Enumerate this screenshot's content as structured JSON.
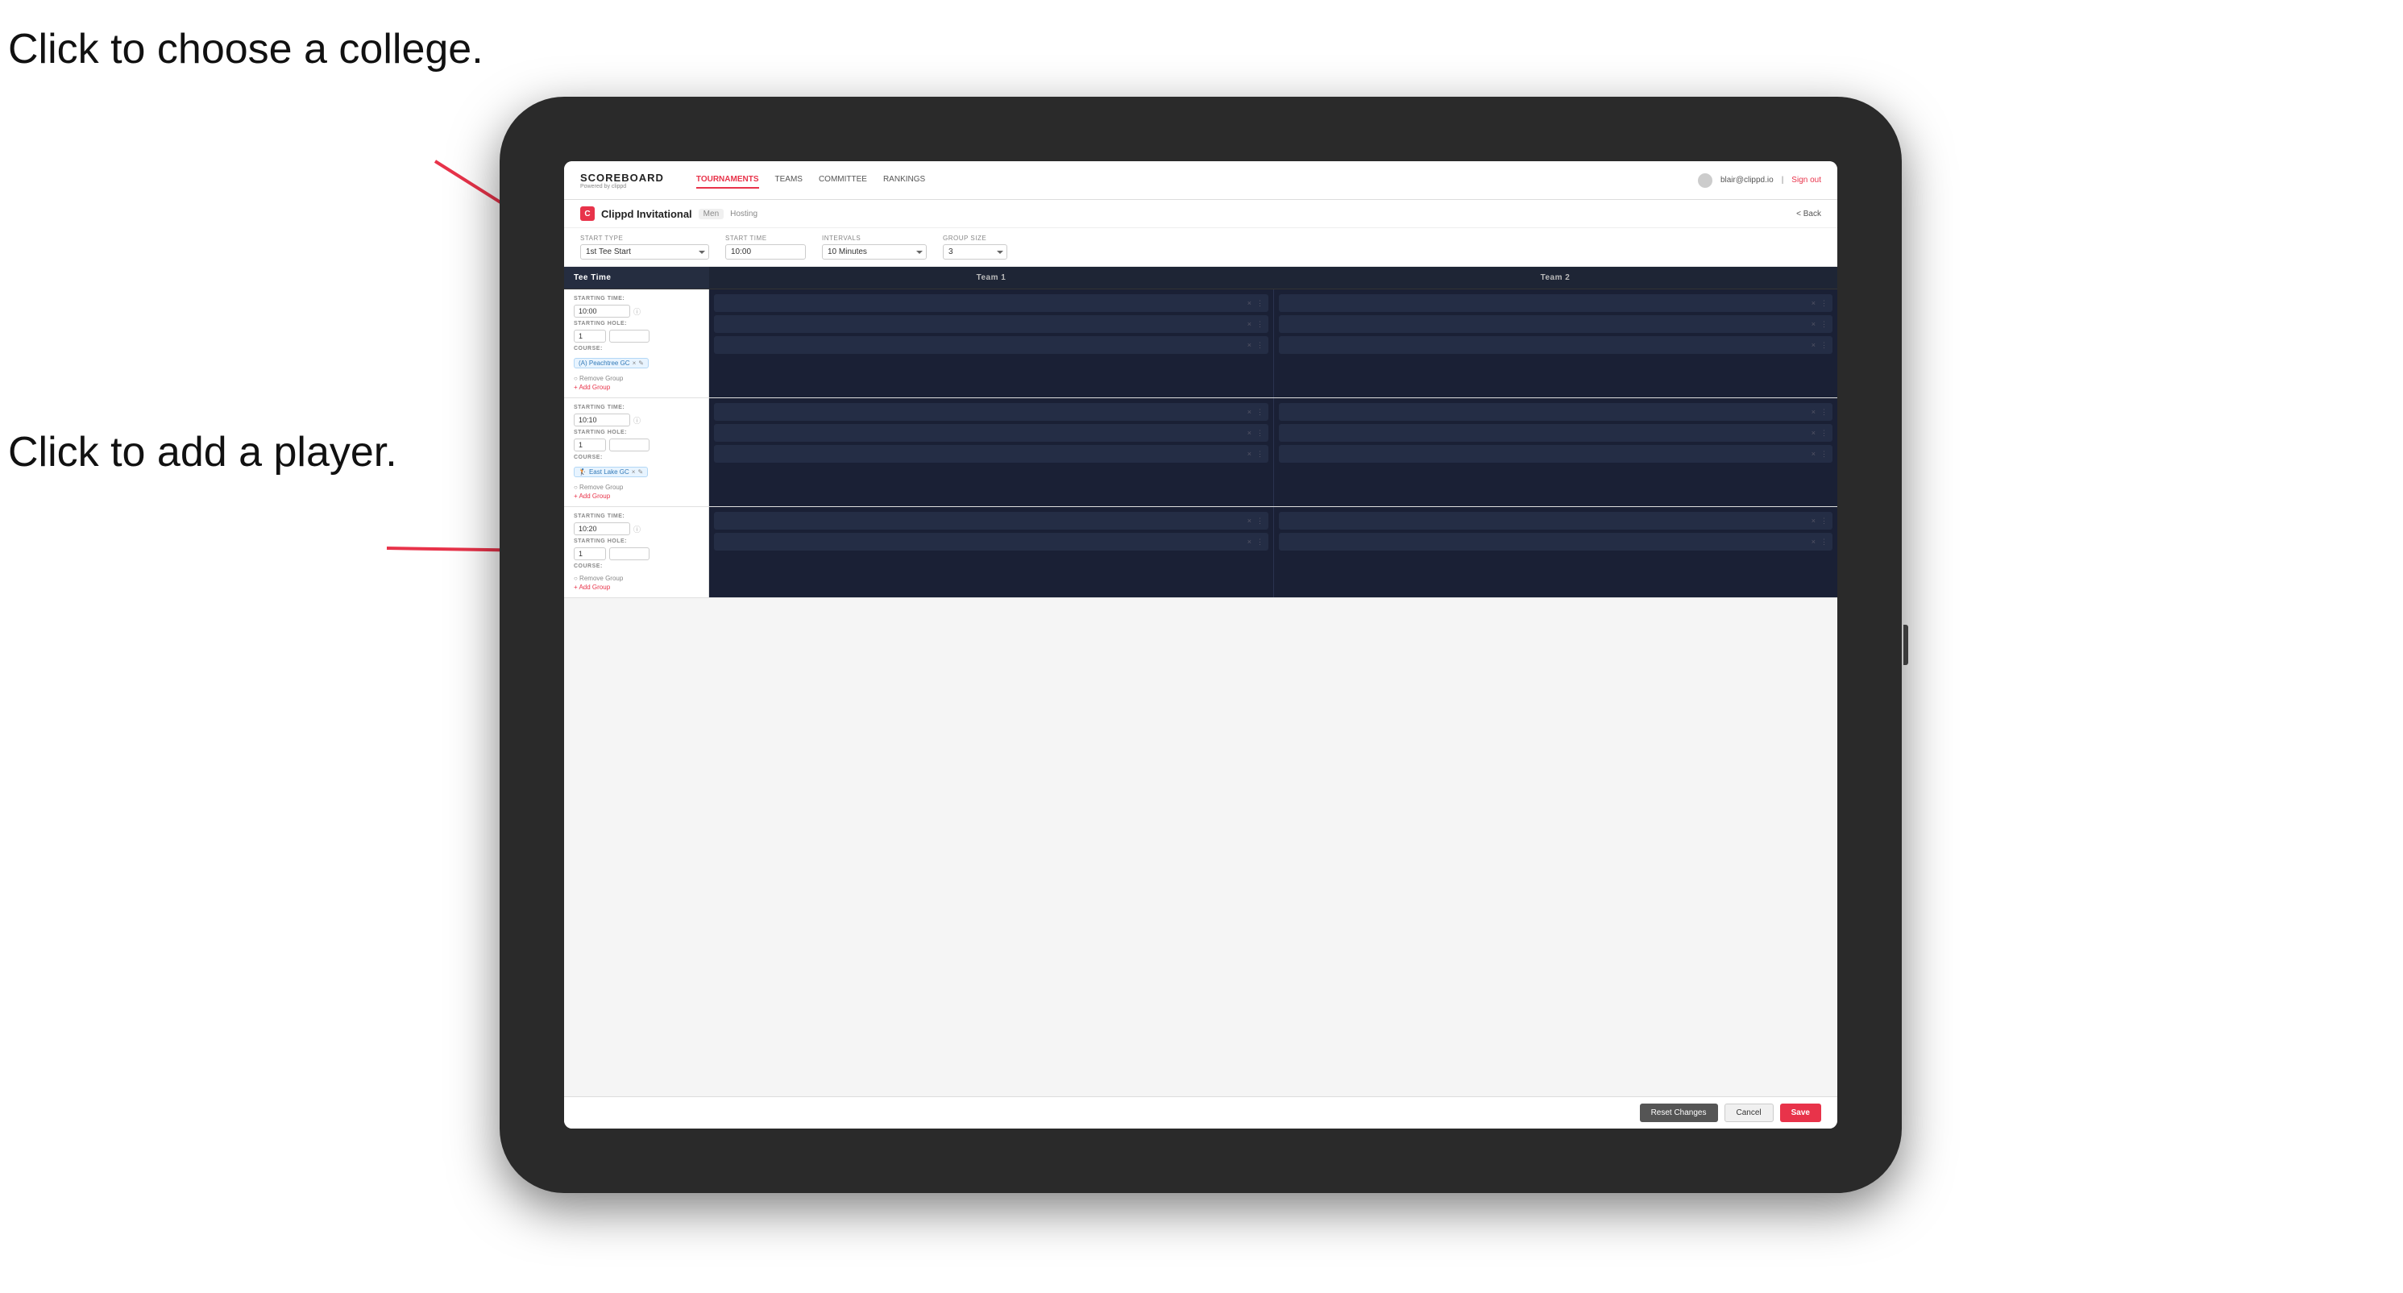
{
  "annotations": {
    "top_left": "Click to choose a\ncollege.",
    "bottom_left": "Click to add\na player."
  },
  "nav": {
    "brand": "SCOREBOARD",
    "brand_sub": "Powered by clippd",
    "links": [
      "TOURNAMENTS",
      "TEAMS",
      "COMMITTEE",
      "RANKINGS"
    ],
    "active_link": "TOURNAMENTS",
    "user_email": "blair@clippd.io",
    "sign_out": "Sign out"
  },
  "page": {
    "title": "Clippd Invitational",
    "tag": "Men",
    "hosting": "Hosting",
    "back": "Back"
  },
  "form": {
    "start_type_label": "Start Type",
    "start_type_value": "1st Tee Start",
    "start_time_label": "Start Time",
    "start_time_value": "10:00",
    "intervals_label": "Intervals",
    "intervals_value": "10 Minutes",
    "group_size_label": "Group Size",
    "group_size_value": "3"
  },
  "table": {
    "col1": "Tee Time",
    "col2": "Team 1",
    "col3": "Team 2"
  },
  "groups": [
    {
      "starting_time_label": "STARTING TIME:",
      "starting_time": "10:00",
      "starting_hole_label": "STARTING HOLE:",
      "starting_hole": "1",
      "course_label": "COURSE:",
      "course": "(A) Peachtree GC",
      "remove_group": "Remove Group",
      "add_group": "Add Group"
    },
    {
      "starting_time_label": "STARTING TIME:",
      "starting_time": "10:10",
      "starting_hole_label": "STARTING HOLE:",
      "starting_hole": "1",
      "course_label": "COURSE:",
      "course": "East Lake GC",
      "remove_group": "Remove Group",
      "add_group": "Add Group"
    },
    {
      "starting_time_label": "STARTING TIME:",
      "starting_time": "10:20",
      "starting_hole_label": "STARTING HOLE:",
      "starting_hole": "1",
      "course_label": "COURSE:",
      "course": "",
      "remove_group": "Remove Group",
      "add_group": "Add Group"
    }
  ],
  "buttons": {
    "reset": "Reset Changes",
    "cancel": "Cancel",
    "save": "Save"
  }
}
